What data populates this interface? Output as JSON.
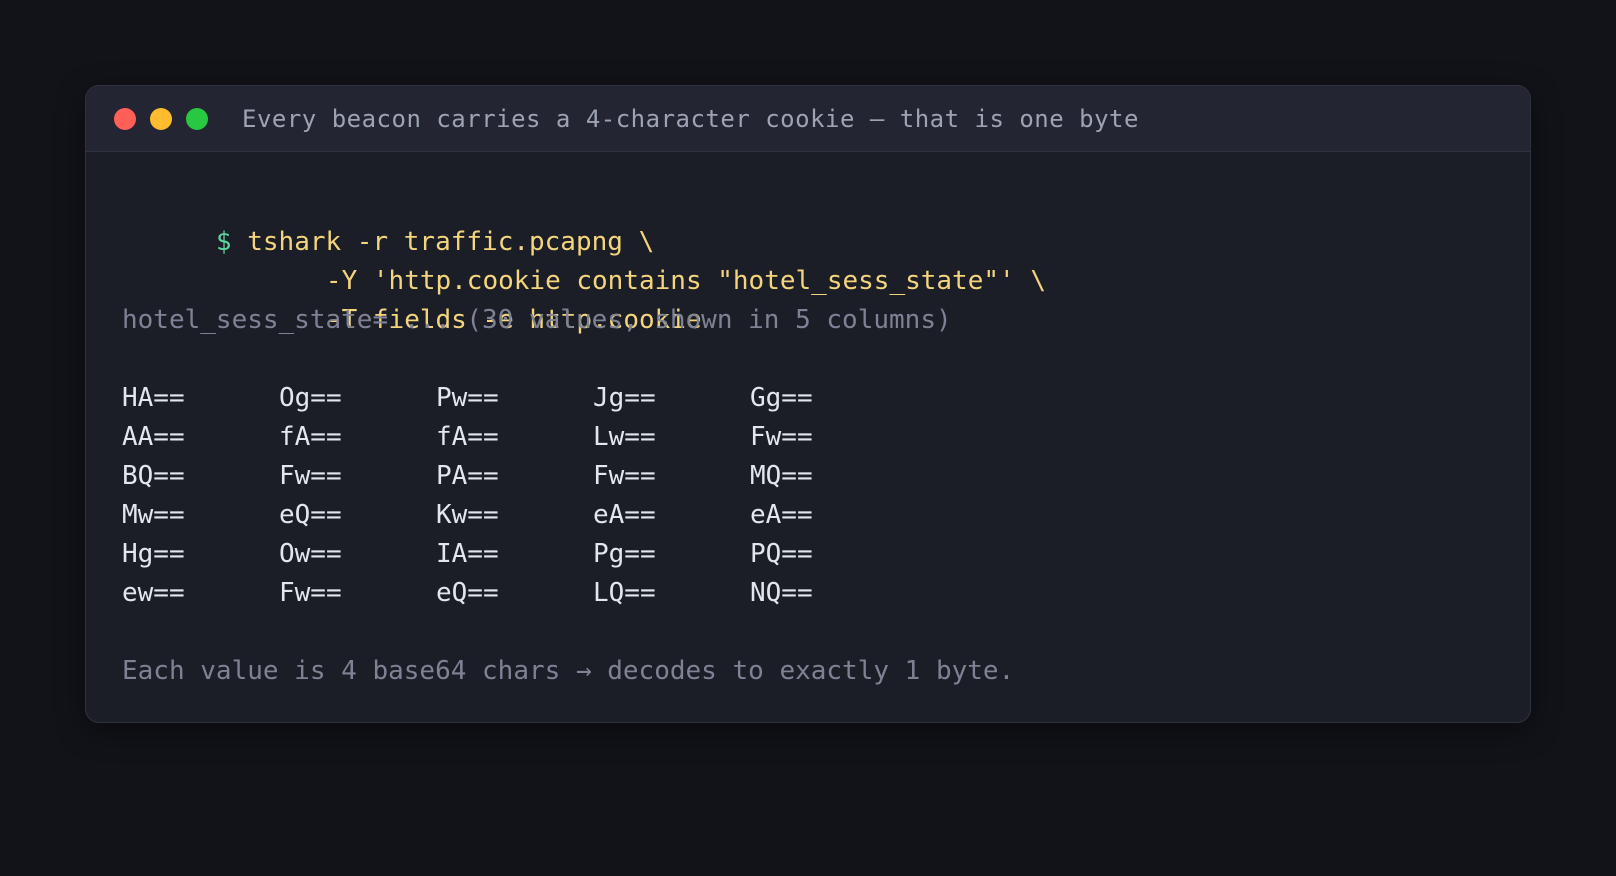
{
  "window": {
    "title": "Every beacon carries a 4-character cookie — that is one byte",
    "controls": [
      "close",
      "minimize",
      "maximize"
    ]
  },
  "terminal": {
    "prompt": "$",
    "command_lines": [
      "tshark -r traffic.pcapng \\",
      "-Y 'http.cookie contains \"hotel_sess_state\"' \\",
      "-T fields -e http.cookie"
    ],
    "summary": "hotel_sess_state= ... (30 values, shown in 5 columns)",
    "values": [
      [
        "HA==",
        "Og==",
        "Pw==",
        "Jg==",
        "Gg=="
      ],
      [
        "AA==",
        "fA==",
        "fA==",
        "Lw==",
        "Fw=="
      ],
      [
        "BQ==",
        "Fw==",
        "PA==",
        "Fw==",
        "MQ=="
      ],
      [
        "Mw==",
        "eQ==",
        "Kw==",
        "eA==",
        "eA=="
      ],
      [
        "Hg==",
        "Ow==",
        "IA==",
        "Pg==",
        "PQ=="
      ],
      [
        "ew==",
        "Fw==",
        "eQ==",
        "LQ==",
        "NQ=="
      ]
    ],
    "footer": "Each value is 4 base64 chars → decodes to exactly 1 byte."
  },
  "colors": {
    "background": "#121319",
    "window": "#1c1e27",
    "titlebar": "#232632",
    "prompt": "#5fd39e",
    "command": "#f4d57e",
    "muted": "#7d8294",
    "value": "#e3e6ef",
    "close": "#ff5f57",
    "minimize": "#febc2e",
    "maximize": "#28c840"
  }
}
